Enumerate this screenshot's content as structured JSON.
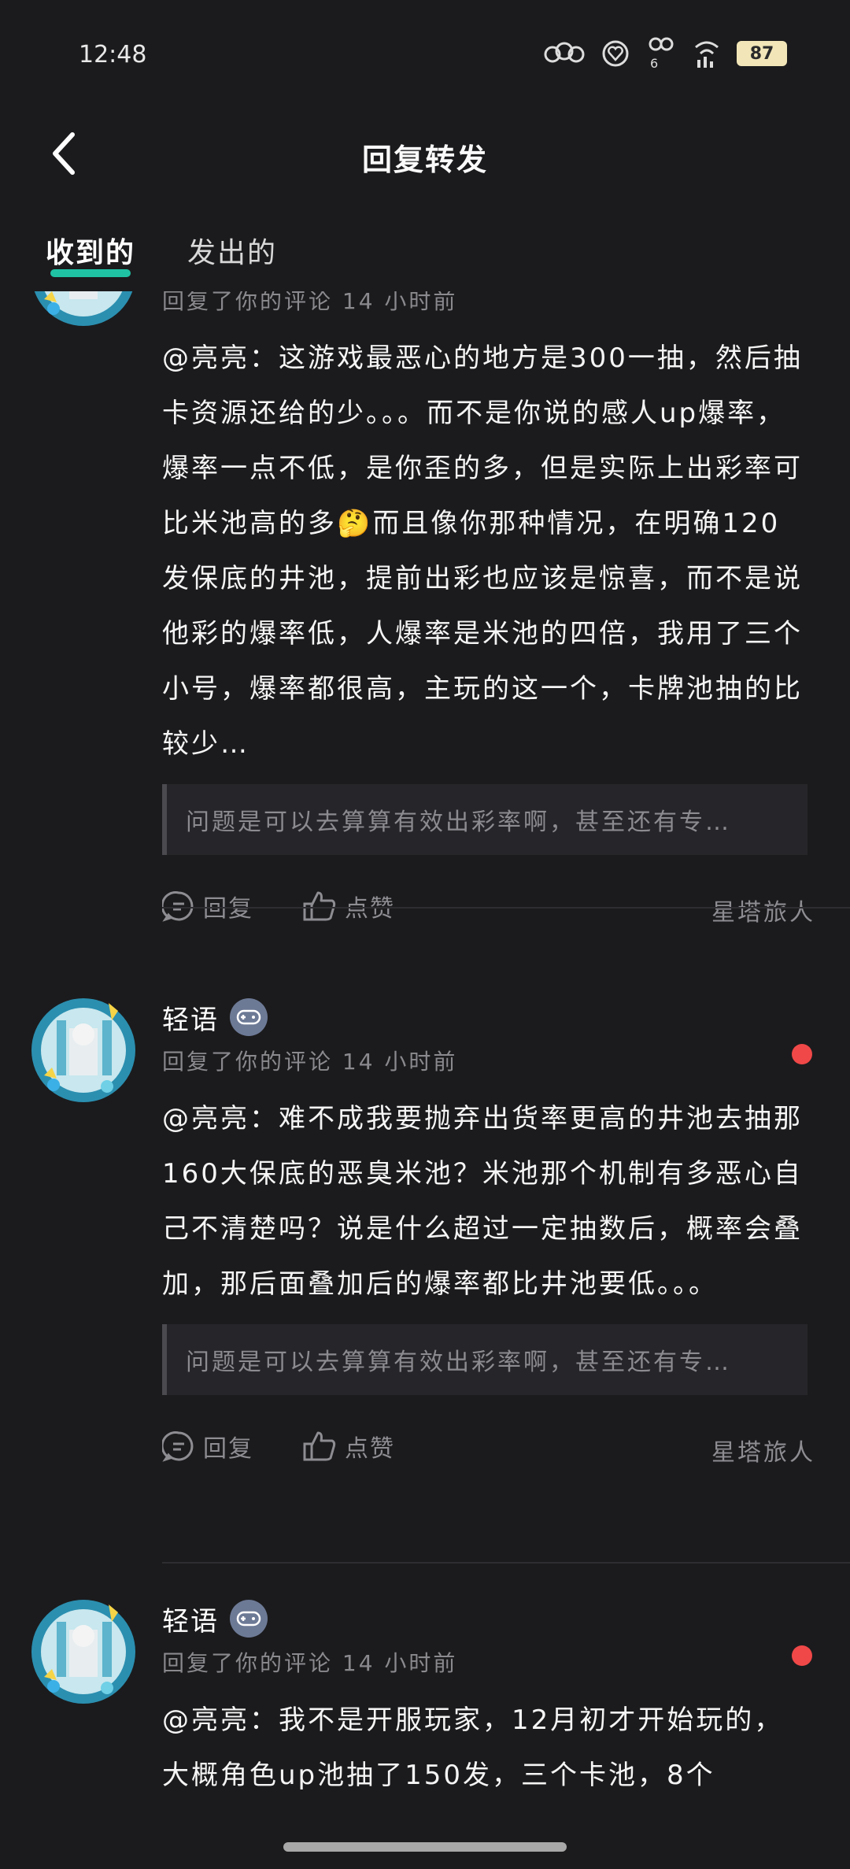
{
  "status_bar": {
    "time": "12:48",
    "battery": "87",
    "signal_label": "6"
  },
  "header": {
    "title": "回复转发"
  },
  "tabs": [
    {
      "label": "收到的",
      "active": true
    },
    {
      "label": "发出的",
      "active": false
    }
  ],
  "comments": [
    {
      "meta": "回复了你的评论 14 小时前",
      "text": "@亮亮：这游戏最恶心的地方是300一抽，然后抽卡资源还给的少。。。而不是你说的感人up爆率，爆率一点不低，是你歪的多，但是实际上出彩率可比米池高的多🤔而且像你那种情况，在明确120发保底的井池，提前出彩也应该是惊喜，而不是说他彩的爆率低，人爆率是米池的四倍，我用了三个小号，爆率都很高，主玩的这一个，卡牌池抽的比较少…",
      "quote": "问题是可以去算算有效出彩率啊，甚至还有专…",
      "reply_label": "回复",
      "like_label": "点赞",
      "source": "星塔旅人"
    },
    {
      "username": "轻语",
      "meta": "回复了你的评论 14 小时前",
      "text": "@亮亮：难不成我要抛弃出货率更高的井池去抽那160大保底的恶臭米池？米池那个机制有多恶心自己不清楚吗？说是什么超过一定抽数后，概率会叠加，那后面叠加后的爆率都比井池要低。。。",
      "quote": "问题是可以去算算有效出彩率啊，甚至还有专…",
      "reply_label": "回复",
      "like_label": "点赞",
      "source": "星塔旅人",
      "unread": true
    },
    {
      "username": "轻语",
      "meta": "回复了你的评论 14 小时前",
      "text": "@亮亮：我不是开服玩家，12月初才开始玩的，大概角色up池抽了150发，三个卡池，8个",
      "unread": true
    }
  ],
  "colors": {
    "accent": "#1fc3a4",
    "unread": "#f04848",
    "background": "#1b1b1d"
  }
}
